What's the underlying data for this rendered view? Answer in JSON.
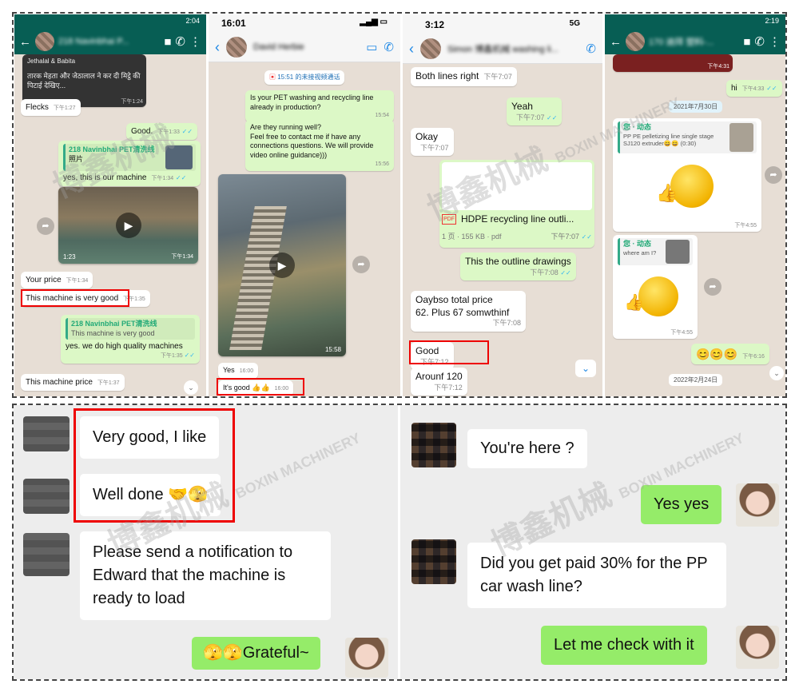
{
  "phone1": {
    "time": "2:04",
    "contact": "218 Navinbhai P...",
    "post_title": "Jethalal & Babita",
    "post_caption": "तारक मेहता और जेठालाल ने कर दी मिट्ठे की पिटाई देखिए...",
    "post_time": "下午1:24",
    "messages": [
      {
        "text": "Flecks",
        "time": "下午1:27"
      },
      {
        "text": "Good.",
        "time": "下午1:33"
      },
      {
        "quote_name": "218 Navinbhai PET清洗线",
        "quote_text": "照片",
        "text": "yes, this is our machine",
        "time": "下午1:34"
      },
      {
        "video_duration": "1:23",
        "time": "下午1:34"
      },
      {
        "text": "Your price",
        "time": "下午1:34"
      },
      {
        "text": "This machine is very good",
        "time": "下午1:35"
      },
      {
        "quote_name": "218 Navinbhai PET清洗线",
        "quote_text": "This machine is very good",
        "text": "yes. we do high quality machines",
        "time": "下午1:35"
      },
      {
        "text": "This machine price",
        "time": "下午1:37"
      }
    ]
  },
  "phone2": {
    "time": "16:01",
    "contact": "David Herbie",
    "call_link": "15:51 的未接视频通话",
    "messages": [
      {
        "text": "Is your PET washing and recycling line already in production?",
        "time": "15:54"
      },
      {
        "text": "Are they running well?\nFeel free to contact me if have any connections questions. We will provide video online guidance)))",
        "time": "15:56"
      },
      {
        "video_duration": "15:58"
      },
      {
        "text": "Yes",
        "time": "16:00"
      },
      {
        "text": "It's good 👍👍",
        "time": "16:00"
      }
    ]
  },
  "phone3": {
    "time": "3:12",
    "network": "5G",
    "contact": "Simon 博鑫机械 washing li...",
    "messages": [
      {
        "text": "Both lines right",
        "time": "下午7:07"
      },
      {
        "text": "Yeah",
        "time": "下午7:07"
      },
      {
        "text": "Okay",
        "time": "下午7:07"
      },
      {
        "file_name": "HDPE recycling line outli...",
        "file_meta": "1 页 · 155 KB · pdf",
        "time": "下午7:07"
      },
      {
        "text": "This the outline drawings",
        "time": "下午7:08"
      },
      {
        "text": "Oaybso total price\n62. Plus 67 somwthinf",
        "time": "下午7:08"
      },
      {
        "text": "Good",
        "time": "下午7:12"
      },
      {
        "text": "Arounf 120",
        "time": "下午7:12"
      }
    ]
  },
  "phone4": {
    "time": "2:19",
    "contact": "170 迪拜 塑料-...",
    "messages": [
      {
        "time": "下午4:31"
      },
      {
        "text": "hi",
        "time": "下午4:33"
      },
      {
        "date": "2021年7月30日"
      },
      {
        "status_from": "您 · 动态",
        "status_text": "PP PE pelletizing line single stage SJ120 extruder😄😄 (0:30)",
        "time": "下午4:55"
      },
      {
        "status_from": "您 · 动态",
        "status_text": "where am I?",
        "time": "下午4:55"
      },
      {
        "text": "😊😊😊",
        "time": "下午6:16"
      },
      {
        "date": "2022年2月24日"
      }
    ]
  },
  "wechat_left": {
    "messages": [
      {
        "side": "in",
        "text": "Very good, I like"
      },
      {
        "side": "in",
        "text": "Well done 🤝🫣"
      },
      {
        "side": "in",
        "text": "Please send a notification to Edward that the machine is ready to load"
      },
      {
        "side": "out",
        "text": "🫣🫣Grateful~"
      }
    ]
  },
  "wechat_right": {
    "messages": [
      {
        "side": "in",
        "text": "You're here ?"
      },
      {
        "side": "out",
        "text": "Yes yes"
      },
      {
        "side": "in",
        "text": "Did you get paid 30% for the PP car wash line?"
      },
      {
        "side": "out",
        "text": "Let me check with it"
      }
    ]
  },
  "watermark": {
    "cn": "博鑫机械",
    "en": "BOXIN MACHINERY"
  },
  "colors": {
    "wa_header": "#075e54",
    "wa_out": "#dcf8c6",
    "wechat_out": "#95ec69",
    "highlight": "#e00000"
  }
}
